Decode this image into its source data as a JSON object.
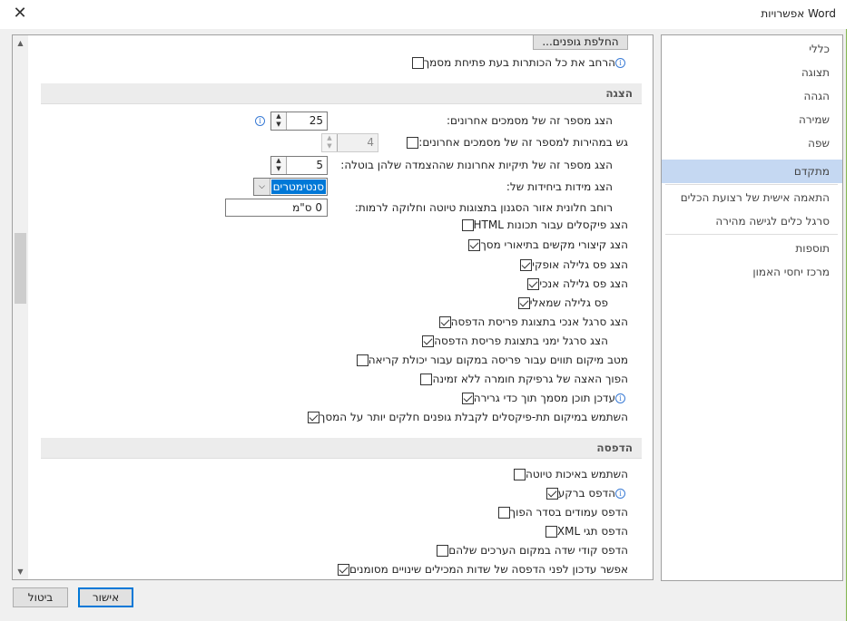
{
  "window": {
    "title": "אפשרויות Word",
    "close_icon": "close-icon"
  },
  "sidebar": {
    "items": [
      {
        "label": "כללי"
      },
      {
        "label": "תצוגה"
      },
      {
        "label": "הגהה"
      },
      {
        "label": "שמירה"
      },
      {
        "label": "שפה"
      },
      {
        "label": "מתקדם",
        "active": true
      },
      {
        "label": "התאמה אישית של רצועת הכלים"
      },
      {
        "label": "סרגל כלים לגישה מהירה"
      },
      {
        "label": "תוספות"
      },
      {
        "label": "מרכז יחסי האמון"
      }
    ]
  },
  "top": {
    "font_button": "החלפת גופנים...",
    "expand_label": "הרחב את כל הכותרות בעת פתיחת מסמך",
    "expand_checked": false
  },
  "display": {
    "title": "הצגה",
    "recent_docs_label": "הצג מספר זה של מסמכים אחרונים:",
    "recent_docs_value": "25",
    "quick_access_label": "גש במהירות למספר זה של מסמכים אחרונים:",
    "quick_access_value": "4",
    "quick_access_checked": false,
    "unpin_folders_label": "הצג מספר זה של תיקיות אחרונות שההצמדה שלהן בוטלה:",
    "unpin_folders_value": "5",
    "units_label": "הצג מידות ביחידות של:",
    "units_value": "סנטימטרים",
    "style_width_label": "רוחב חלונית אזור הסגנון בתצוגות טיוטה וחלוקה לרמות:",
    "style_width_value": "0 ס\"מ",
    "options": [
      {
        "label": "הצג פיקסלים עבור תכונות HTML",
        "checked": false
      },
      {
        "label": "הצג קיצורי מקשים בתיאורי מסך",
        "checked": true
      },
      {
        "label": "הצג פס גלילה אופקי",
        "checked": true
      },
      {
        "label": "הצג פס גלילה אנכי",
        "checked": true
      },
      {
        "label": "פס גלילה שמאלי",
        "checked": true,
        "nested": true
      },
      {
        "label": "הצג סרגל אנכי בתצוגת פריסת הדפסה",
        "checked": true
      },
      {
        "label": "הצג סרגל ימני בתצוגת פריסת הדפסה",
        "checked": true,
        "nested": true
      },
      {
        "label": "מטב מיקום תווים עבור פריסה במקום עבור יכולת קריאה",
        "checked": false
      },
      {
        "label": "הפוך האצה של גרפיקת חומרה ללא זמינה",
        "checked": false
      },
      {
        "label": "עדכן תוכן מסמך תוך כדי גרירה",
        "checked": true,
        "info": true
      },
      {
        "label": "השתמש במיקום תת-פיקסלים לקבלת גופנים חלקים יותר על המסך",
        "checked": true
      }
    ]
  },
  "print": {
    "title": "הדפסה",
    "options": [
      {
        "label": "השתמש באיכות טיוטה",
        "checked": false
      },
      {
        "label": "הדפס ברקע",
        "checked": true,
        "info": true
      },
      {
        "label": "הדפס עמודים בסדר הפוך",
        "checked": false
      },
      {
        "label": "הדפס תגי XML",
        "checked": false
      },
      {
        "label": "הדפס קודי שדה במקום הערכים שלהם",
        "checked": false
      },
      {
        "label": "אפשר עדכון לפני הדפסה של שדות המכילים שינויים מסומנים",
        "checked": true
      }
    ]
  },
  "footer": {
    "ok": "אישור",
    "cancel": "ביטול"
  },
  "colors": {
    "accent": "#0078d7",
    "nav_active": "#c5d8f2"
  }
}
